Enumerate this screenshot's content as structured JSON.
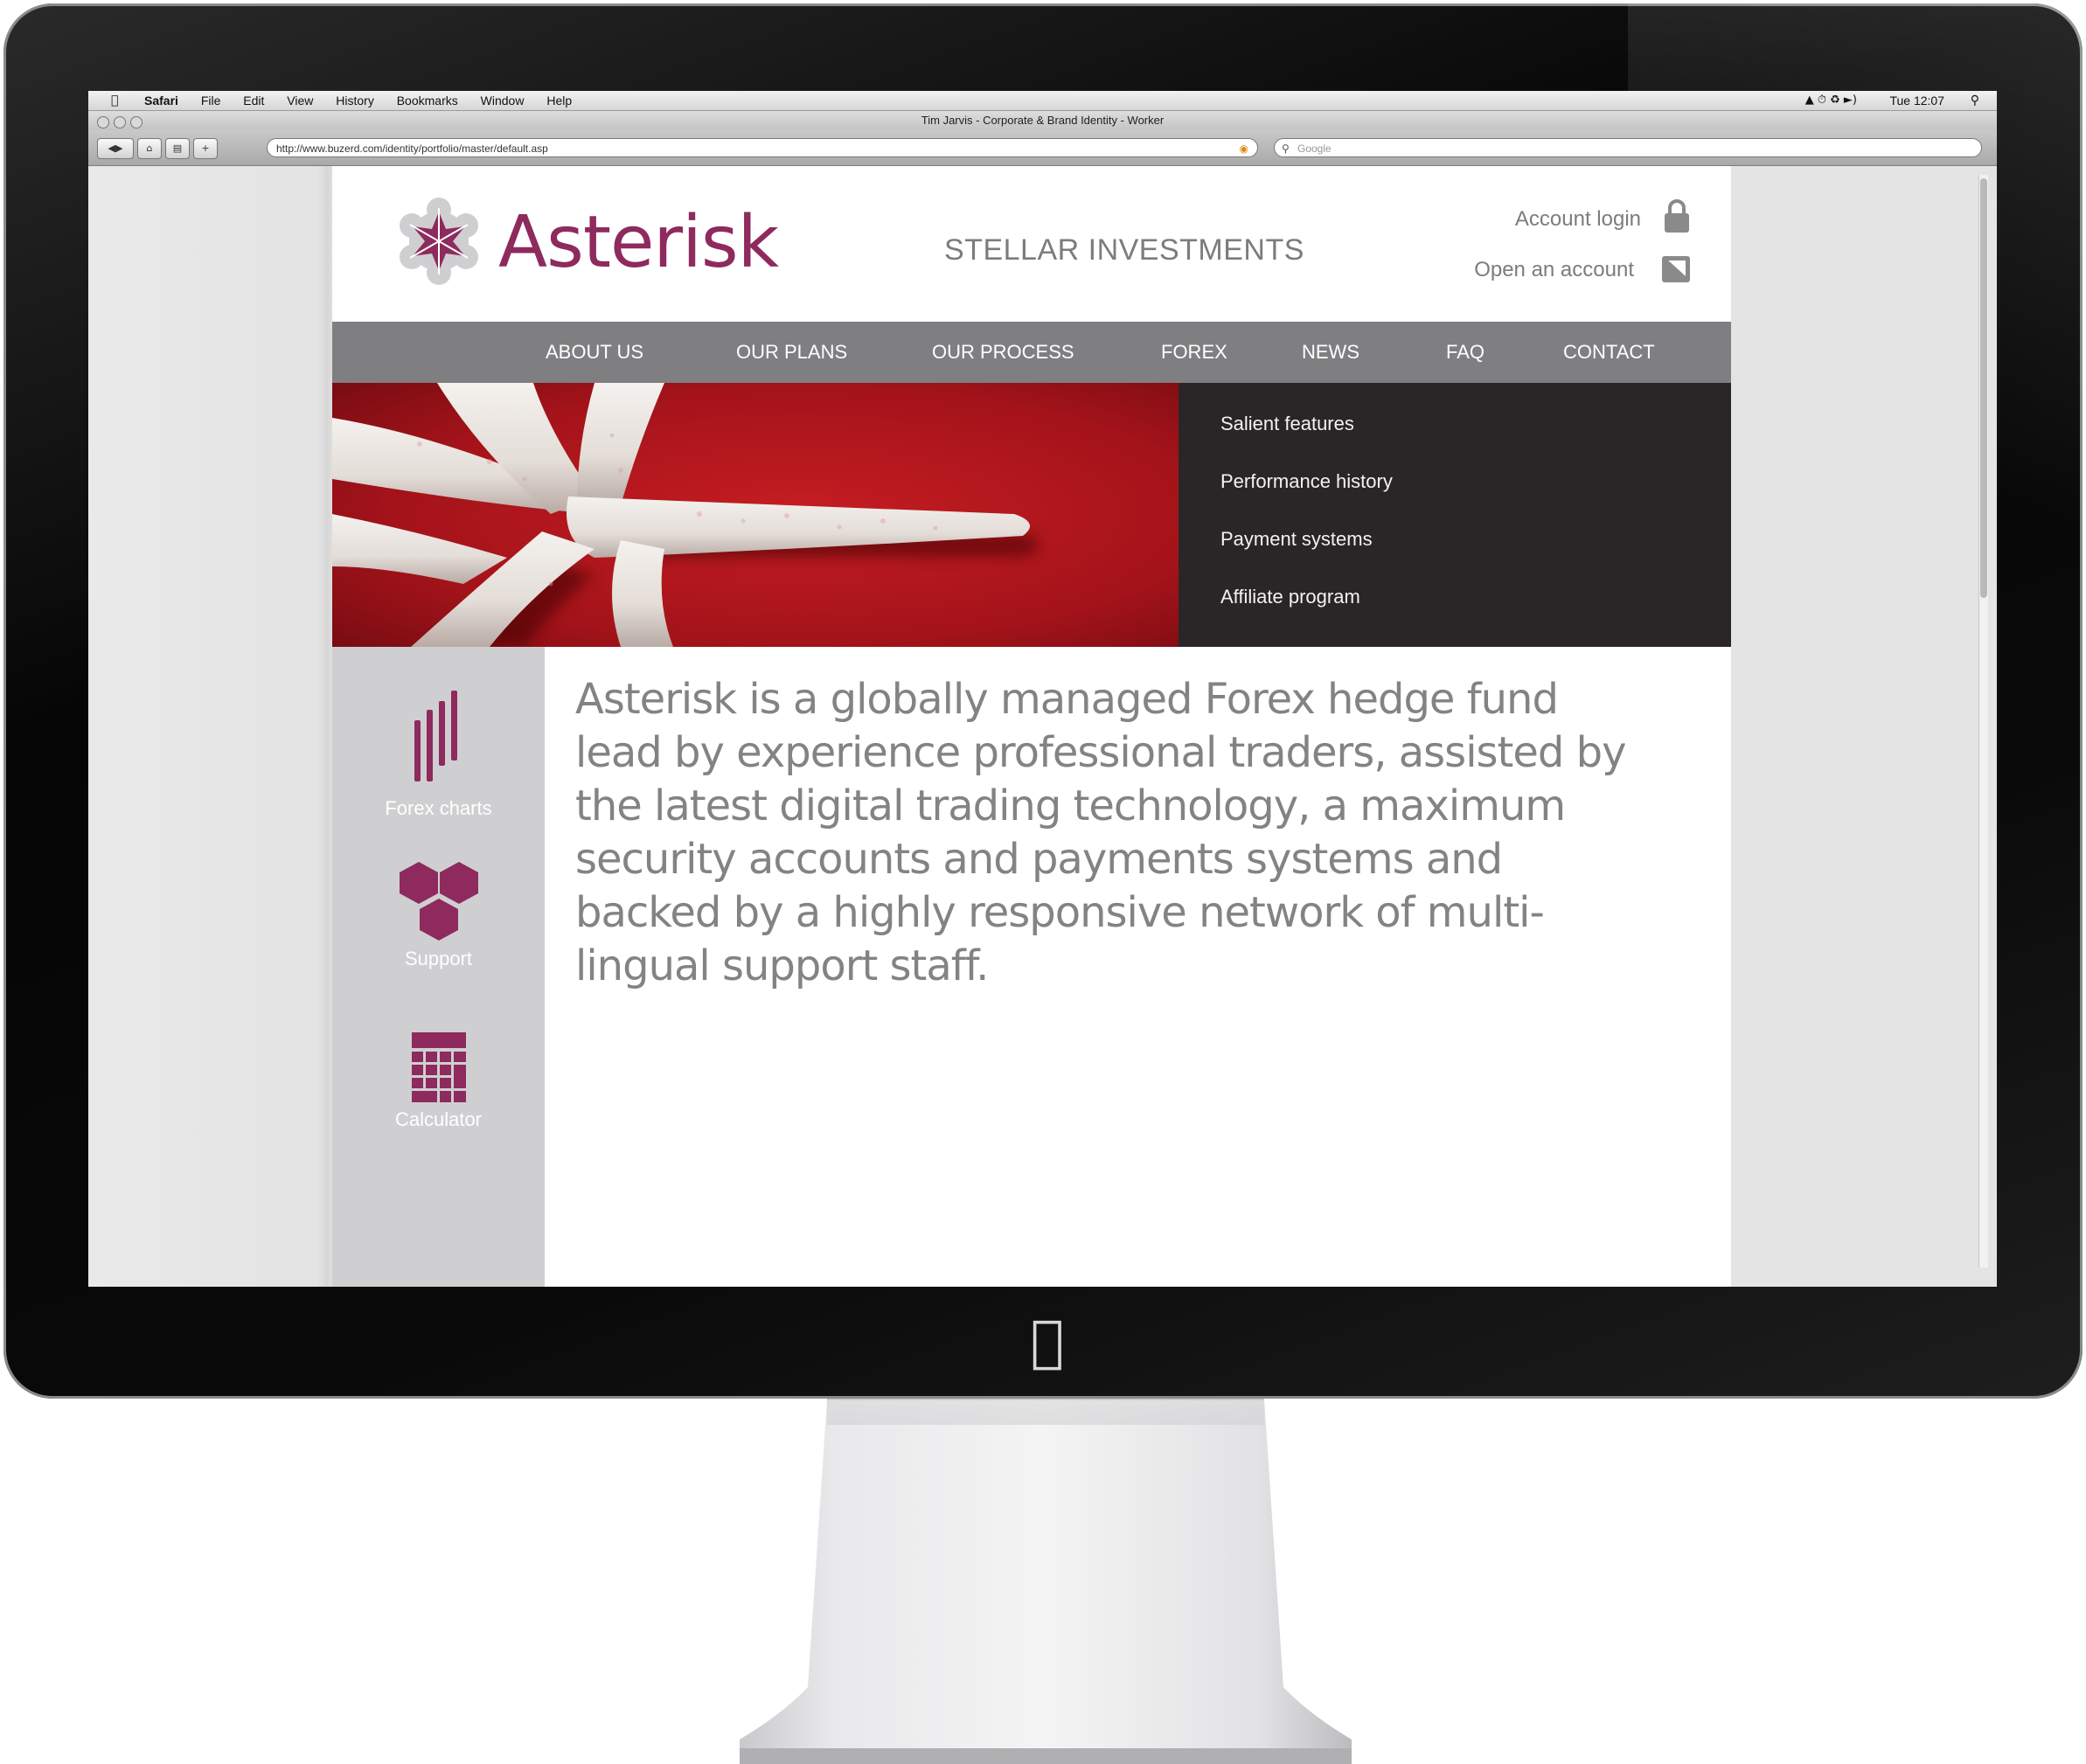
{
  "os_menubar": {
    "app_name": "Safari",
    "menus": [
      "File",
      "Edit",
      "View",
      "History",
      "Bookmarks",
      "Window",
      "Help"
    ],
    "clock": "Tue 12:07"
  },
  "browser": {
    "window_title": "Tim Jarvis - Corporate & Brand Identity - Worker",
    "url": "http://www.buzerd.com/identity/portfolio/master/default.asp",
    "search_placeholder": "Google"
  },
  "site": {
    "brand_name": "Asterisk",
    "tagline": "STELLAR INVESTMENTS",
    "account_login": "Account login",
    "open_account": "Open an account",
    "nav": [
      {
        "label": "ABOUT US"
      },
      {
        "label": "OUR PLANS"
      },
      {
        "label": "OUR PROCESS"
      },
      {
        "label": "FOREX"
      },
      {
        "label": "NEWS"
      },
      {
        "label": "FAQ"
      },
      {
        "label": "CONTACT"
      }
    ],
    "dropdown": [
      {
        "label": "Salient features"
      },
      {
        "label": "Performance history"
      },
      {
        "label": "Payment systems"
      },
      {
        "label": "Affiliate program"
      }
    ],
    "tools": [
      {
        "label": "Forex charts",
        "icon": "bar-chart-icon"
      },
      {
        "label": "Support",
        "icon": "hexagons-icon"
      },
      {
        "label": "Calculator",
        "icon": "calculator-icon"
      }
    ],
    "intro_text": "Asterisk is a globally managed Forex hedge fund lead by experience professional traders, assisted by the latest digital trading technology, a maximum security accounts and payments systems and backed by a highly responsive network of multi-lingual support staff."
  },
  "colors": {
    "brand": "#8e2a5d",
    "nav_bg": "#7f7f81",
    "dropdown_bg": "#2a2627",
    "sidebar_bg": "#cfcfd1",
    "text_gray": "#838385",
    "hero_red": "#b4161b"
  }
}
